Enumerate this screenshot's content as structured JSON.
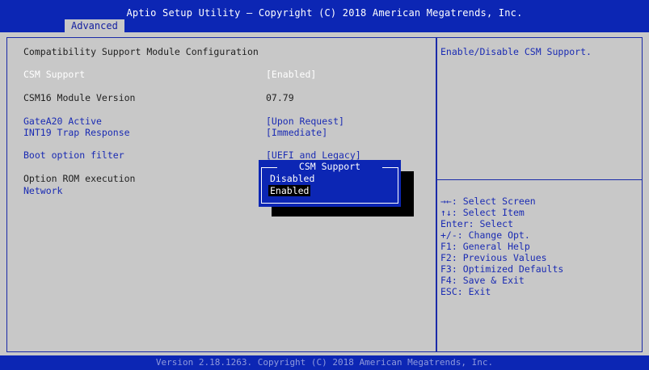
{
  "header": {
    "title": "Aptio Setup Utility – Copyright (C) 2018 American Megatrends, Inc.",
    "active_tab": "Advanced"
  },
  "main": {
    "heading": "Compatibility Support Module Configuration",
    "items": [
      {
        "label": "CSM Support",
        "value": "[Enabled]"
      },
      {
        "label": "CSM16 Module Version",
        "value": "07.79"
      },
      {
        "label": "GateA20 Active",
        "value": "[Upon Request]"
      },
      {
        "label": "INT19 Trap Response",
        "value": "[Immediate]"
      },
      {
        "label": "Boot option filter",
        "value": "[UEFI and Legacy]"
      },
      {
        "label": "Option ROM execution"
      },
      {
        "label": "Network"
      }
    ]
  },
  "popup": {
    "title": "CSM Support",
    "options": [
      "Disabled",
      "Enabled"
    ],
    "selected": "Enabled"
  },
  "help": {
    "description": "Enable/Disable CSM Support.",
    "keys": [
      "→←: Select Screen",
      "↑↓: Select Item",
      "Enter: Select",
      "+/-: Change Opt.",
      "F1: General Help",
      "F2: Previous Values",
      "F3: Optimized Defaults",
      "F4: Save & Exit",
      "ESC: Exit"
    ]
  },
  "footer": {
    "text": "Version 2.18.1263. Copyright (C) 2018 American Megatrends, Inc."
  },
  "colors": {
    "header_blue": "#0c26b4",
    "panel_gray": "#c8c8c8",
    "link_blue": "#1a2bb3",
    "highlight_white": "#ffffff"
  }
}
